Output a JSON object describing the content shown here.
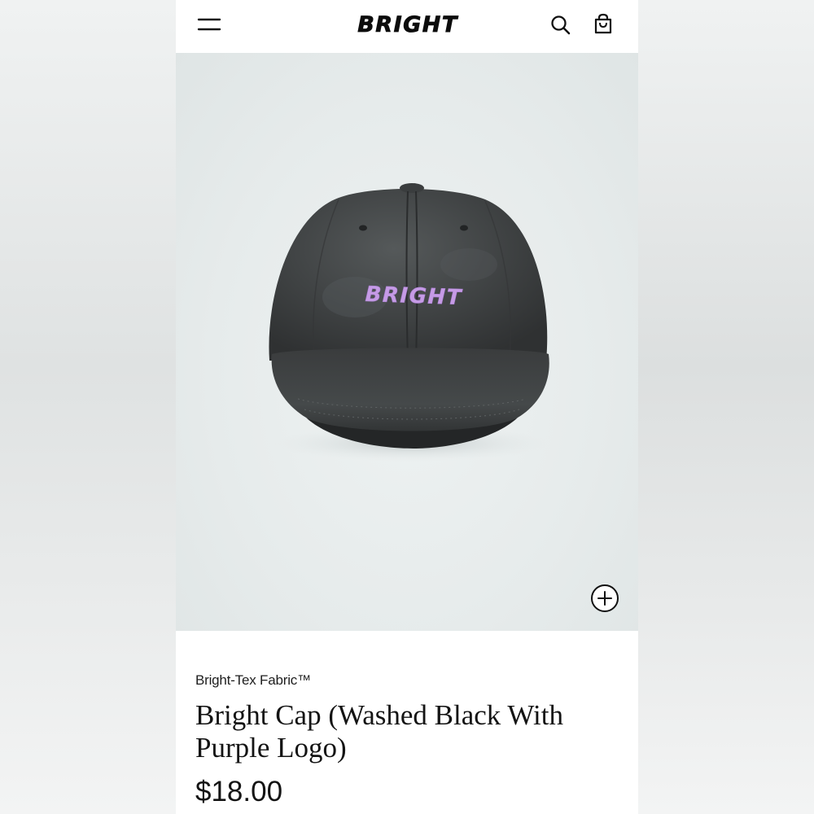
{
  "header": {
    "brand": "BRIGHT",
    "menu_icon": "hamburger-menu-icon",
    "search_icon": "search-icon",
    "cart_icon": "shopping-bag-icon"
  },
  "product_image": {
    "embroidered_text": "BRIGHT",
    "zoom_icon": "plus-circle-icon"
  },
  "product": {
    "fabric": "Bright-Tex Fabric™",
    "title": "Bright Cap (Washed Black With Purple Logo)",
    "price": "$18.00"
  },
  "colors": {
    "logo_purple": "#c69be6",
    "cap": "#3c3e3e",
    "text": "#141414"
  }
}
